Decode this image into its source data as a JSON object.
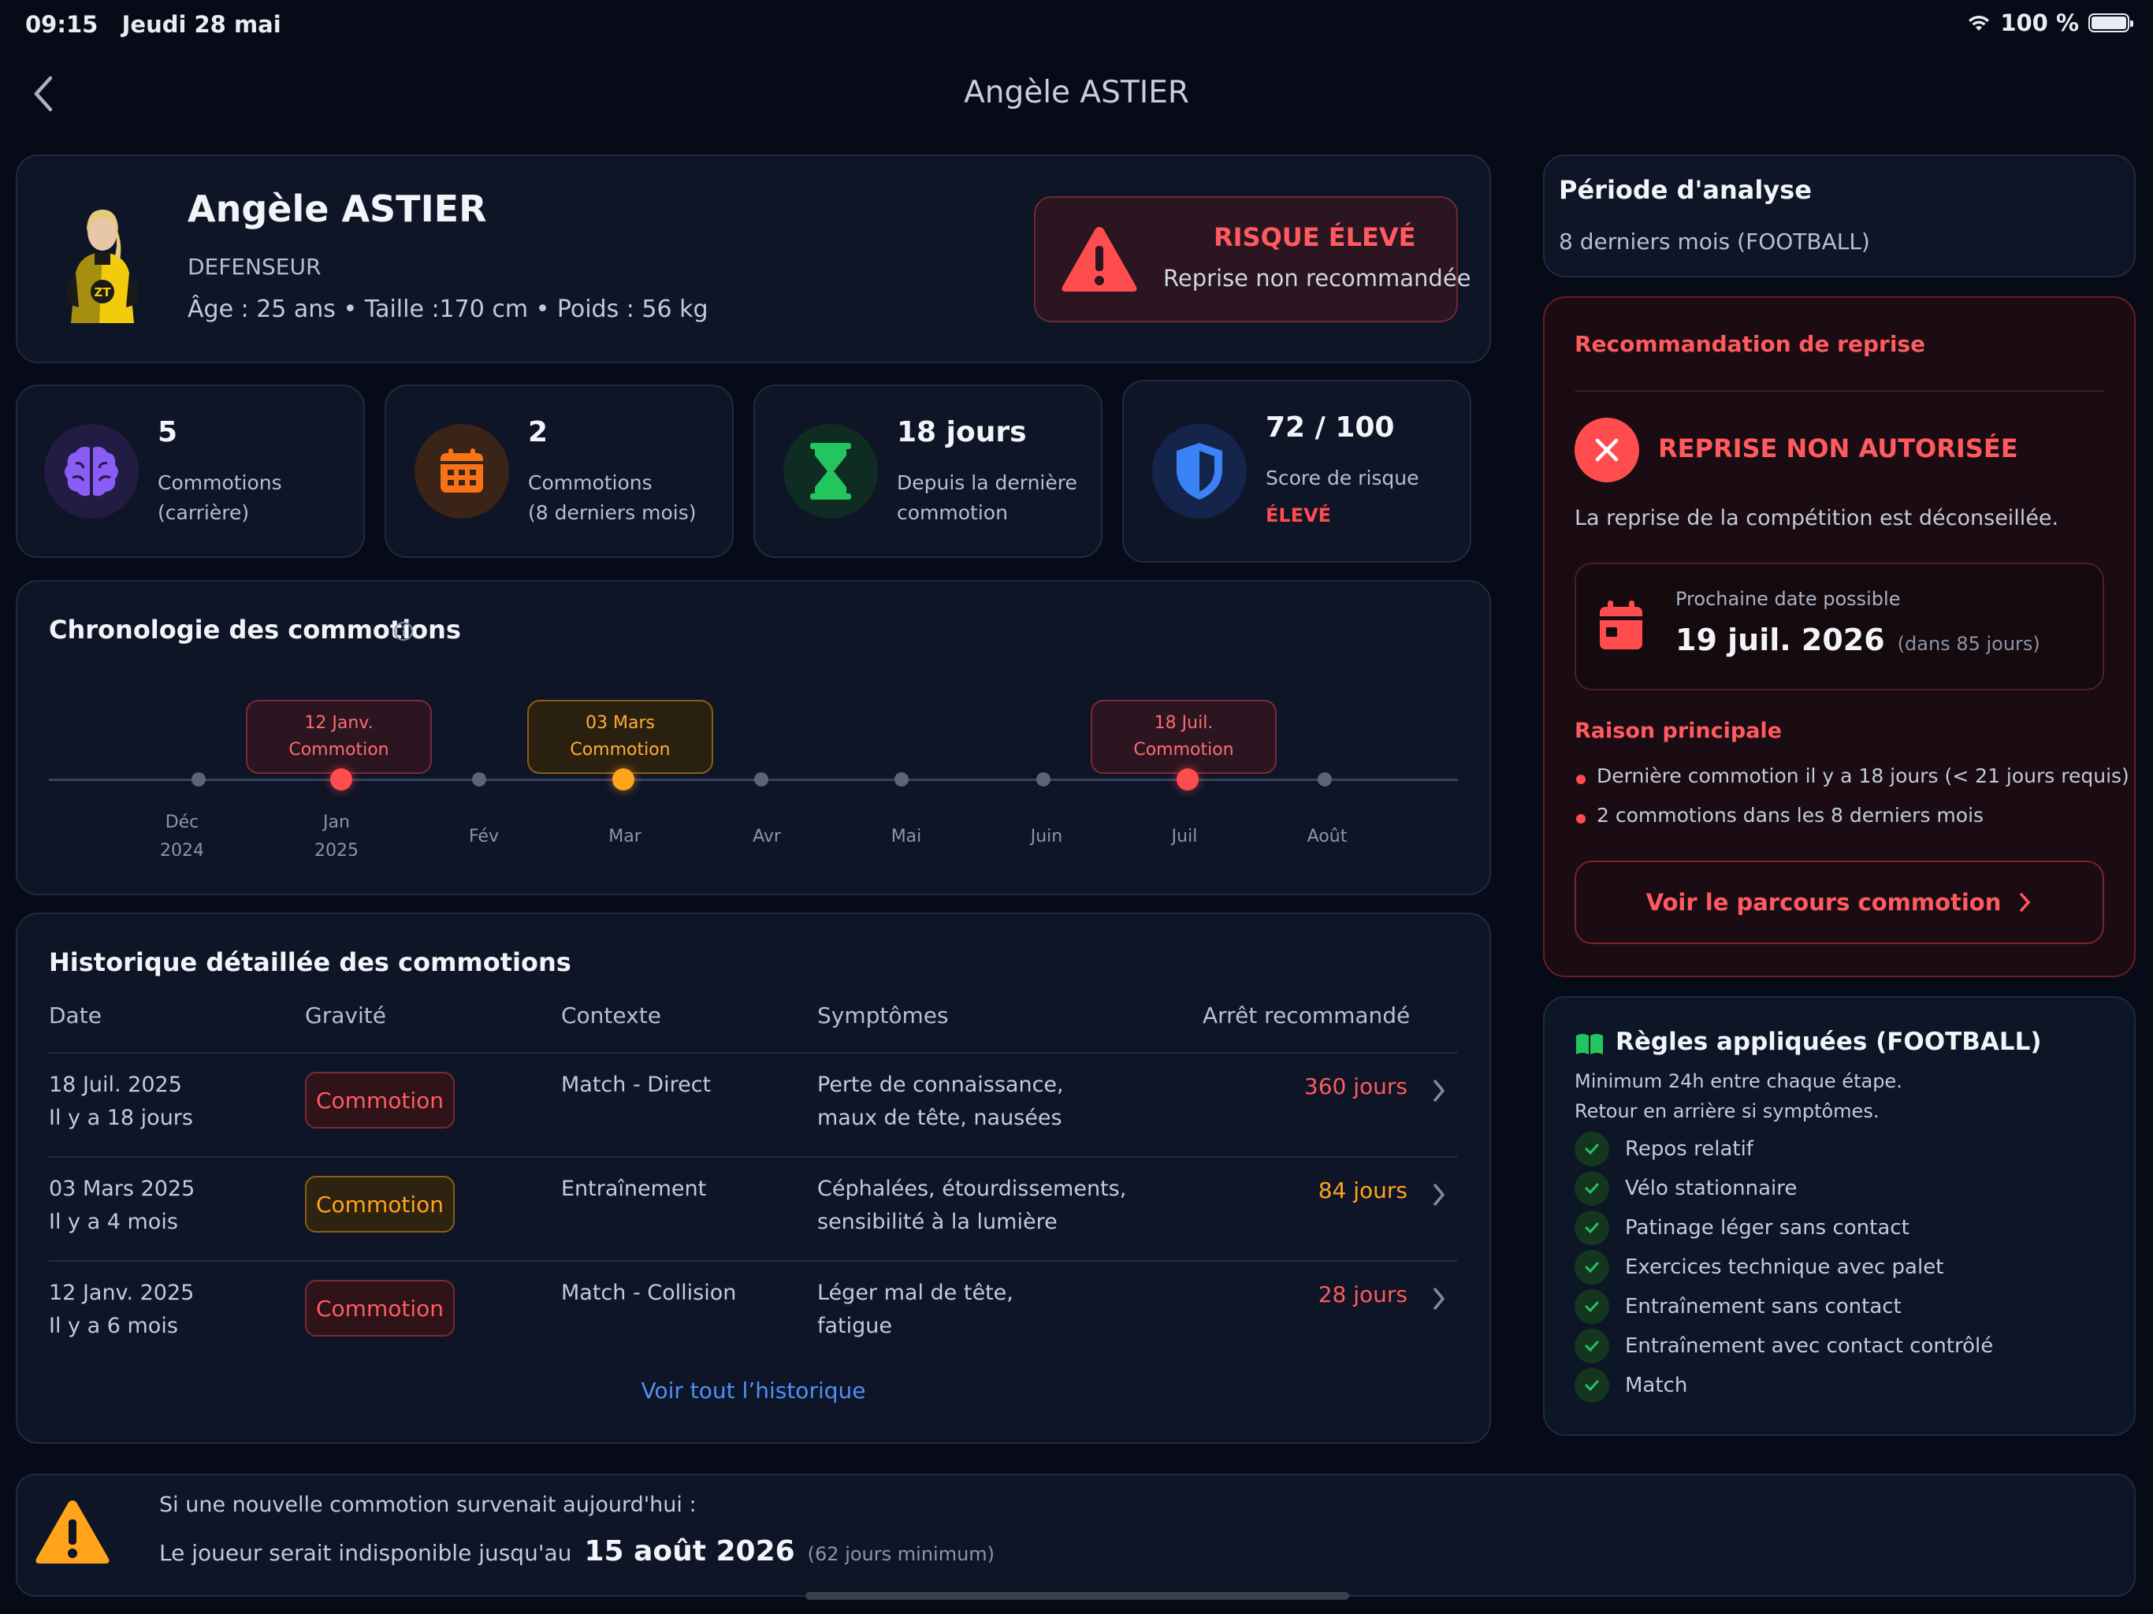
{
  "status_bar": {
    "time": "09:15",
    "date": "Jeudi 28 mai",
    "battery": "100 %"
  },
  "header": {
    "title": "Angèle ASTIER"
  },
  "profile": {
    "name": "Angèle ASTIER",
    "position": "DEFENSEUR",
    "details": "Âge : 25 ans • Taille :170 cm • Poids : 56 kg",
    "jersey_text": "ZT",
    "risk_title": "RISQUE ÉLEVÉ",
    "risk_subtitle": "Reprise non recommandée"
  },
  "stats": [
    {
      "value": "5",
      "label1": "Commotions",
      "label2": "(carrière)",
      "icon": "brain-icon"
    },
    {
      "value": "2",
      "label1": "Commotions",
      "label2": "(8 derniers mois)",
      "icon": "calendar-icon"
    },
    {
      "value": "18 jours",
      "label1": "Depuis la dernière",
      "label2": "commotion",
      "icon": "hourglass-icon"
    },
    {
      "value": "72 / 100",
      "label1": "Score de risque",
      "label2": "ÉLEVÉ",
      "icon": "shield-icon"
    }
  ],
  "timeline": {
    "title": "Chronologie des commotions",
    "events": [
      {
        "date": "12 Janv.",
        "label": "Commotion",
        "severity": "red"
      },
      {
        "date": "03 Mars",
        "label": "Commotion",
        "severity": "orange"
      },
      {
        "date": "18 Juil.",
        "label": "Commotion",
        "severity": "red"
      }
    ],
    "months": [
      {
        "name": "Déc",
        "year": "2024"
      },
      {
        "name": "Jan",
        "year": "2025"
      },
      {
        "name": "Fév",
        "year": ""
      },
      {
        "name": "Mar",
        "year": ""
      },
      {
        "name": "Avr",
        "year": ""
      },
      {
        "name": "Mai",
        "year": ""
      },
      {
        "name": "Juin",
        "year": ""
      },
      {
        "name": "Juil",
        "year": ""
      },
      {
        "name": "Août",
        "year": ""
      }
    ]
  },
  "history": {
    "title": "Historique détaillée des commotions",
    "columns": [
      "Date",
      "Gravité",
      "Contexte",
      "Symptômes",
      "Arrêt recommandé"
    ],
    "rows": [
      {
        "date": "18 Juil. 2025",
        "ago": "Il y a 18 jours",
        "gravity": "Commotion",
        "gravity_color": "red",
        "context": "Match - Direct",
        "symptoms1": "Perte de connaissance,",
        "symptoms2": "maux de tête, nausées",
        "stop": "360 jours",
        "stop_color": "#ff5a5f"
      },
      {
        "date": "03 Mars 2025",
        "ago": "Il y a 4 mois",
        "gravity": "Commotion",
        "gravity_color": "orange",
        "context": "Entraînement",
        "symptoms1": "Céphalées, étourdissements,",
        "symptoms2": "sensibilité à la lumière",
        "stop": "84 jours",
        "stop_color": "#ffa41b"
      },
      {
        "date": "12 Janv. 2025",
        "ago": "Il y a 6 mois",
        "gravity": "Commotion",
        "gravity_color": "red",
        "context": "Match - Collision",
        "symptoms1": "Léger mal de tête,",
        "symptoms2": "fatigue",
        "stop": "28 jours",
        "stop_color": "#ff5a5f"
      }
    ],
    "see_all": "Voir tout l’historique"
  },
  "analysis": {
    "title": "Période d'analyse",
    "value": "8 derniers mois (FOOTBALL)"
  },
  "recommendation": {
    "title": "Recommandation de reprise",
    "status": "REPRISE NON AUTORISÉE",
    "description": "La reprise de la compétition est déconseillée.",
    "next_label": "Prochaine date possible",
    "next_date": "19 juil. 2026",
    "next_delay": "(dans 85 jours)",
    "reason_title": "Raison principale",
    "reasons": [
      "Dernière commotion il y a 18 jours (< 21 jours requis)",
      "2 commotions dans les 8 derniers mois"
    ],
    "button": "Voir le parcours commotion"
  },
  "rules": {
    "title": "Règles appliquées (FOOTBALL)",
    "line1": "Minimum 24h entre chaque étape.",
    "line2": "Retour en arrière si symptômes.",
    "steps": [
      "Repos relatif",
      "Vélo stationnaire",
      "Patinage léger sans contact",
      "Exercices technique avec palet",
      "Entraînement sans contact",
      "Entraînement avec contact contrôlé",
      "Match"
    ]
  },
  "warning": {
    "line1": "Si une nouvelle commotion survenait aujourd'hui :",
    "line2_prefix": "Le joueur serait indisponible jusqu'au",
    "date": "15 août 2026",
    "note": "(62 jours minimum)"
  }
}
